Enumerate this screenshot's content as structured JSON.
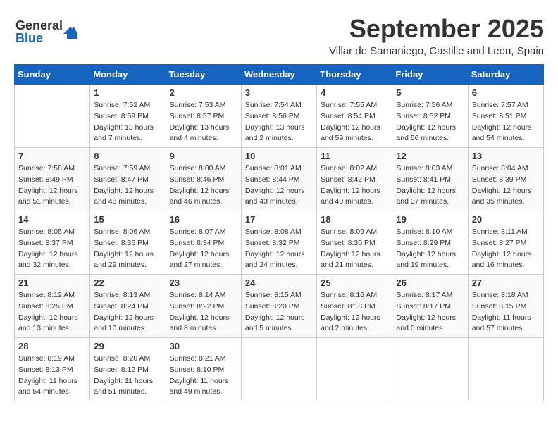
{
  "header": {
    "logo_line1": "General",
    "logo_line2": "Blue",
    "month_title": "September 2025",
    "subtitle": "Villar de Samaniego, Castille and Leon, Spain"
  },
  "columns": [
    "Sunday",
    "Monday",
    "Tuesday",
    "Wednesday",
    "Thursday",
    "Friday",
    "Saturday"
  ],
  "weeks": [
    [
      {
        "day": "",
        "info": ""
      },
      {
        "day": "1",
        "info": "Sunrise: 7:52 AM\nSunset: 8:59 PM\nDaylight: 13 hours\nand 7 minutes."
      },
      {
        "day": "2",
        "info": "Sunrise: 7:53 AM\nSunset: 8:57 PM\nDaylight: 13 hours\nand 4 minutes."
      },
      {
        "day": "3",
        "info": "Sunrise: 7:54 AM\nSunset: 8:56 PM\nDaylight: 13 hours\nand 2 minutes."
      },
      {
        "day": "4",
        "info": "Sunrise: 7:55 AM\nSunset: 8:54 PM\nDaylight: 12 hours\nand 59 minutes."
      },
      {
        "day": "5",
        "info": "Sunrise: 7:56 AM\nSunset: 8:52 PM\nDaylight: 12 hours\nand 56 minutes."
      },
      {
        "day": "6",
        "info": "Sunrise: 7:57 AM\nSunset: 8:51 PM\nDaylight: 12 hours\nand 54 minutes."
      }
    ],
    [
      {
        "day": "7",
        "info": "Sunrise: 7:58 AM\nSunset: 8:49 PM\nDaylight: 12 hours\nand 51 minutes."
      },
      {
        "day": "8",
        "info": "Sunrise: 7:59 AM\nSunset: 8:47 PM\nDaylight: 12 hours\nand 48 minutes."
      },
      {
        "day": "9",
        "info": "Sunrise: 8:00 AM\nSunset: 8:46 PM\nDaylight: 12 hours\nand 46 minutes."
      },
      {
        "day": "10",
        "info": "Sunrise: 8:01 AM\nSunset: 8:44 PM\nDaylight: 12 hours\nand 43 minutes."
      },
      {
        "day": "11",
        "info": "Sunrise: 8:02 AM\nSunset: 8:42 PM\nDaylight: 12 hours\nand 40 minutes."
      },
      {
        "day": "12",
        "info": "Sunrise: 8:03 AM\nSunset: 8:41 PM\nDaylight: 12 hours\nand 37 minutes."
      },
      {
        "day": "13",
        "info": "Sunrise: 8:04 AM\nSunset: 8:39 PM\nDaylight: 12 hours\nand 35 minutes."
      }
    ],
    [
      {
        "day": "14",
        "info": "Sunrise: 8:05 AM\nSunset: 8:37 PM\nDaylight: 12 hours\nand 32 minutes."
      },
      {
        "day": "15",
        "info": "Sunrise: 8:06 AM\nSunset: 8:36 PM\nDaylight: 12 hours\nand 29 minutes."
      },
      {
        "day": "16",
        "info": "Sunrise: 8:07 AM\nSunset: 8:34 PM\nDaylight: 12 hours\nand 27 minutes."
      },
      {
        "day": "17",
        "info": "Sunrise: 8:08 AM\nSunset: 8:32 PM\nDaylight: 12 hours\nand 24 minutes."
      },
      {
        "day": "18",
        "info": "Sunrise: 8:09 AM\nSunset: 8:30 PM\nDaylight: 12 hours\nand 21 minutes."
      },
      {
        "day": "19",
        "info": "Sunrise: 8:10 AM\nSunset: 8:29 PM\nDaylight: 12 hours\nand 19 minutes."
      },
      {
        "day": "20",
        "info": "Sunrise: 8:11 AM\nSunset: 8:27 PM\nDaylight: 12 hours\nand 16 minutes."
      }
    ],
    [
      {
        "day": "21",
        "info": "Sunrise: 8:12 AM\nSunset: 8:25 PM\nDaylight: 12 hours\nand 13 minutes."
      },
      {
        "day": "22",
        "info": "Sunrise: 8:13 AM\nSunset: 8:24 PM\nDaylight: 12 hours\nand 10 minutes."
      },
      {
        "day": "23",
        "info": "Sunrise: 8:14 AM\nSunset: 8:22 PM\nDaylight: 12 hours\nand 8 minutes."
      },
      {
        "day": "24",
        "info": "Sunrise: 8:15 AM\nSunset: 8:20 PM\nDaylight: 12 hours\nand 5 minutes."
      },
      {
        "day": "25",
        "info": "Sunrise: 8:16 AM\nSunset: 8:18 PM\nDaylight: 12 hours\nand 2 minutes."
      },
      {
        "day": "26",
        "info": "Sunrise: 8:17 AM\nSunset: 8:17 PM\nDaylight: 12 hours\nand 0 minutes."
      },
      {
        "day": "27",
        "info": "Sunrise: 8:18 AM\nSunset: 8:15 PM\nDaylight: 11 hours\nand 57 minutes."
      }
    ],
    [
      {
        "day": "28",
        "info": "Sunrise: 8:19 AM\nSunset: 8:13 PM\nDaylight: 11 hours\nand 54 minutes."
      },
      {
        "day": "29",
        "info": "Sunrise: 8:20 AM\nSunset: 8:12 PM\nDaylight: 11 hours\nand 51 minutes."
      },
      {
        "day": "30",
        "info": "Sunrise: 8:21 AM\nSunset: 8:10 PM\nDaylight: 11 hours\nand 49 minutes."
      },
      {
        "day": "",
        "info": ""
      },
      {
        "day": "",
        "info": ""
      },
      {
        "day": "",
        "info": ""
      },
      {
        "day": "",
        "info": ""
      }
    ]
  ]
}
